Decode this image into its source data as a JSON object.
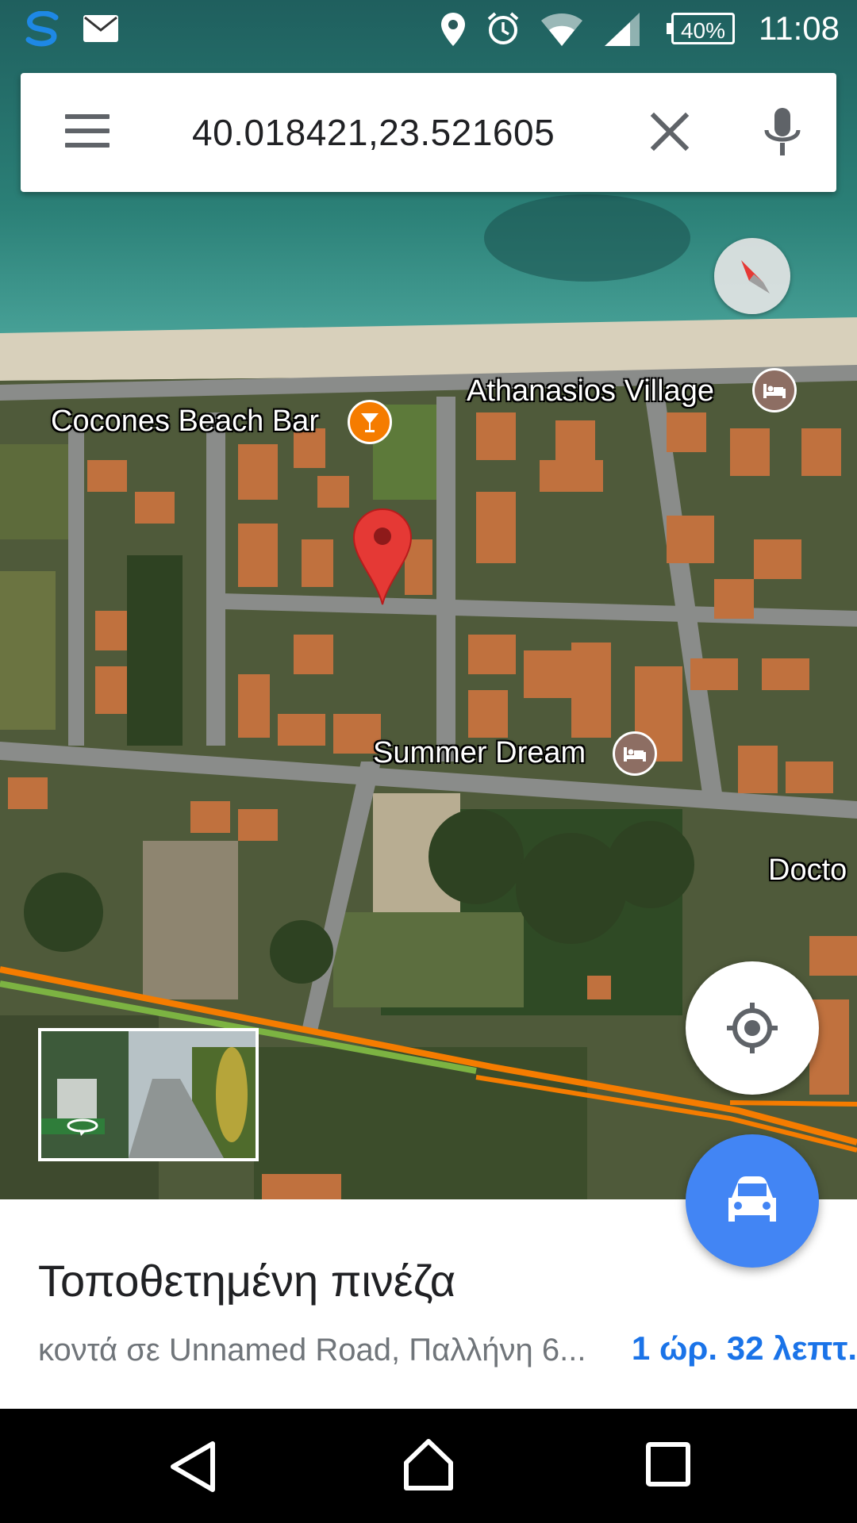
{
  "status_bar": {
    "time": "11:08",
    "battery": "40%",
    "icons": [
      "s-app-icon",
      "mail-icon",
      "location-icon",
      "alarm-icon",
      "wifi-icon",
      "signal-icon",
      "battery-icon"
    ]
  },
  "search": {
    "query": "40.018421,23.521605",
    "icons": [
      "menu-icon",
      "clear-icon",
      "mic-icon"
    ]
  },
  "map": {
    "type": "satellite",
    "labels": [
      {
        "name": "Cocones Beach Bar",
        "icon": "bar-icon",
        "icon_color": "#f57c00"
      },
      {
        "name": "Athanasios Village",
        "icon": "hotel-icon",
        "icon_color": "#8d6e63"
      },
      {
        "name": "Summer Dream",
        "icon": "hotel-icon",
        "icon_color": "#8d6e63"
      },
      {
        "name": "Docto"
      }
    ],
    "pin_color": "#e53935",
    "traffic_colors": [
      "#f57c00",
      "#7cb342"
    ]
  },
  "place": {
    "title": "Τοποθετημένη πινέζα",
    "address": "κοντά σε Unnamed Road, Παλλήνη 6...",
    "eta": "1 ώρ. 32 λεπτ."
  },
  "accent_color": "#4285f4"
}
